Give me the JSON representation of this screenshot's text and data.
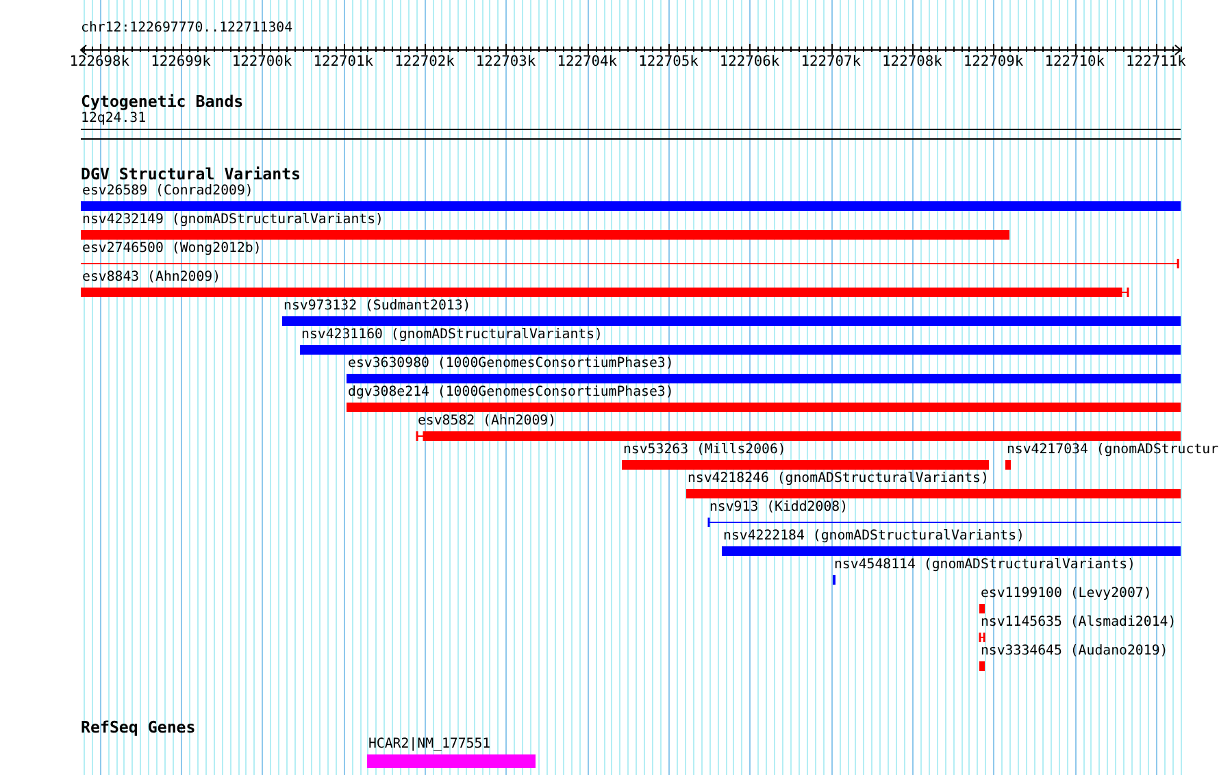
{
  "ruler": {
    "location": "chr12:122697770..122711304",
    "labels": [
      "122698k",
      "122699k",
      "122700k",
      "122701k",
      "122702k",
      "122703k",
      "122704k",
      "122705k",
      "122706k",
      "122707k",
      "122708k",
      "122709k",
      "122710k",
      "122711k"
    ]
  },
  "cytogenetic_bands": {
    "title": "Cytogenetic Bands",
    "band": "12q24.31"
  },
  "dgv_structural_variants": {
    "title": "DGV Structural Variants",
    "rows": [
      {
        "features": [
          {
            "label": "esv26589 (Conrad2009)",
            "color": "#0000ff",
            "segments": [
              {
                "kind": "block"
              }
            ]
          }
        ]
      },
      {
        "features": [
          {
            "label": "nsv4232149 (gnomADStructuralVariants)",
            "color": "#ff0000",
            "segments": [
              {
                "kind": "block"
              }
            ]
          }
        ]
      },
      {
        "features": [
          {
            "label": "esv2746500 (Wong2012b)",
            "color": "#ff0000",
            "segments": [
              {
                "kind": "line"
              }
            ]
          }
        ]
      },
      {
        "features": [
          {
            "label": "esv8843 (Ahn2009)",
            "color": "#ff0000",
            "segments": [
              {
                "kind": "block"
              },
              {
                "kind": "line"
              }
            ]
          }
        ]
      },
      {
        "features": [
          {
            "label": "nsv973132 (Sudmant2013)",
            "color": "#0000ff",
            "segments": [
              {
                "kind": "block"
              }
            ]
          }
        ]
      },
      {
        "features": [
          {
            "label": "nsv4231160 (gnomADStructuralVariants)",
            "color": "#0000ff",
            "segments": [
              {
                "kind": "block"
              }
            ]
          }
        ]
      },
      {
        "features": [
          {
            "label": "esv3630980 (1000GenomesConsortiumPhase3)",
            "color": "#0000ff",
            "segments": [
              {
                "kind": "block"
              }
            ]
          }
        ]
      },
      {
        "features": [
          {
            "label": "dgv308e214 (1000GenomesConsortiumPhase3)",
            "color": "#ff0000",
            "segments": [
              {
                "kind": "block"
              }
            ]
          }
        ]
      },
      {
        "features": [
          {
            "label": "esv8582 (Ahn2009)",
            "color": "#ff0000",
            "segments": [
              {
                "kind": "line"
              },
              {
                "kind": "block"
              }
            ]
          }
        ]
      },
      {
        "features": [
          {
            "label": "nsv53263 (Mills2006)",
            "color": "#ff0000",
            "segments": [
              {
                "kind": "block"
              }
            ]
          },
          {
            "label": "nsv4217034 (gnomADStructur",
            "color": "#ff0000",
            "segments": [
              {
                "kind": "block"
              }
            ]
          }
        ]
      },
      {
        "features": [
          {
            "label": "nsv4218246 (gnomADStructuralVariants)",
            "color": "#ff0000",
            "segments": [
              {
                "kind": "block"
              }
            ]
          }
        ]
      },
      {
        "features": [
          {
            "label": "nsv913 (Kidd2008)",
            "color": "#0000ff",
            "segments": [
              {
                "kind": "line"
              }
            ]
          }
        ]
      },
      {
        "features": [
          {
            "label": "nsv4222184 (gnomADStructuralVariants)",
            "color": "#0000ff",
            "segments": [
              {
                "kind": "block"
              }
            ]
          }
        ]
      },
      {
        "features": [
          {
            "label": "nsv4548114 (gnomADStructuralVariants)",
            "color": "#0000ff",
            "segments": [
              {
                "kind": "block"
              }
            ]
          }
        ]
      },
      {
        "features": [
          {
            "label": "esv1199100 (Levy2007)",
            "color": "#ff0000",
            "segments": [
              {
                "kind": "block"
              }
            ]
          }
        ]
      },
      {
        "features": [
          {
            "label": "nsv1145635 (Alsmadi2014)",
            "color": "#ff0000",
            "segments": [
              {
                "kind": "line"
              }
            ]
          }
        ]
      },
      {
        "features": [
          {
            "label": "nsv3334645 (Audano2019)",
            "color": "#ff0000",
            "segments": [
              {
                "kind": "block"
              }
            ]
          }
        ]
      }
    ]
  },
  "refseq_genes": {
    "title": "RefSeq Genes",
    "genes": [
      {
        "label": "HCAR2|NM_177551",
        "color": "#ff00ff",
        "segments": [
          {
            "kind": "block"
          }
        ]
      }
    ]
  }
}
